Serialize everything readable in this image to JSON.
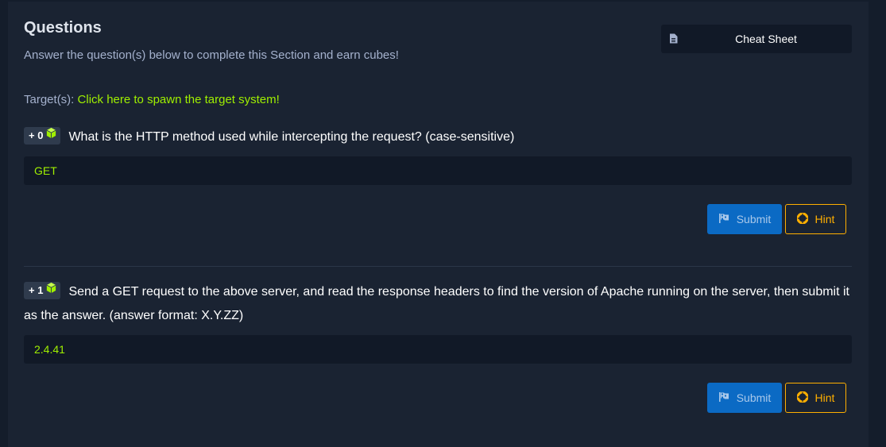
{
  "section": {
    "title": "Questions",
    "subtitle": "Answer the question(s) below to complete this Section and earn cubes!",
    "cheat_sheet_label": "Cheat Sheet",
    "targets_label": "Target(s):",
    "spawn_link": "Click here to spawn the target system!"
  },
  "questions": [
    {
      "cubes": "+ 0",
      "text": "What is the HTTP method used while intercepting the request? (case-sensitive)",
      "answer": "GET",
      "submit_label": "Submit",
      "hint_label": "Hint"
    },
    {
      "cubes": "+ 1",
      "text": "Send a GET request to the above server, and read the response headers to find the version of Apache running on the server, then submit it as the answer. (answer format: X.Y.ZZ)",
      "answer": "2.4.41",
      "submit_label": "Submit",
      "hint_label": "Hint"
    }
  ],
  "colors": {
    "accent_green": "#9fef00",
    "submit_blue": "#0b6ac4",
    "hint_orange": "#ffaf00"
  },
  "icons": {
    "cheat_sheet": "document-icon",
    "cube": "cube-icon",
    "submit": "flag-icon",
    "hint": "lifebuoy-icon"
  }
}
